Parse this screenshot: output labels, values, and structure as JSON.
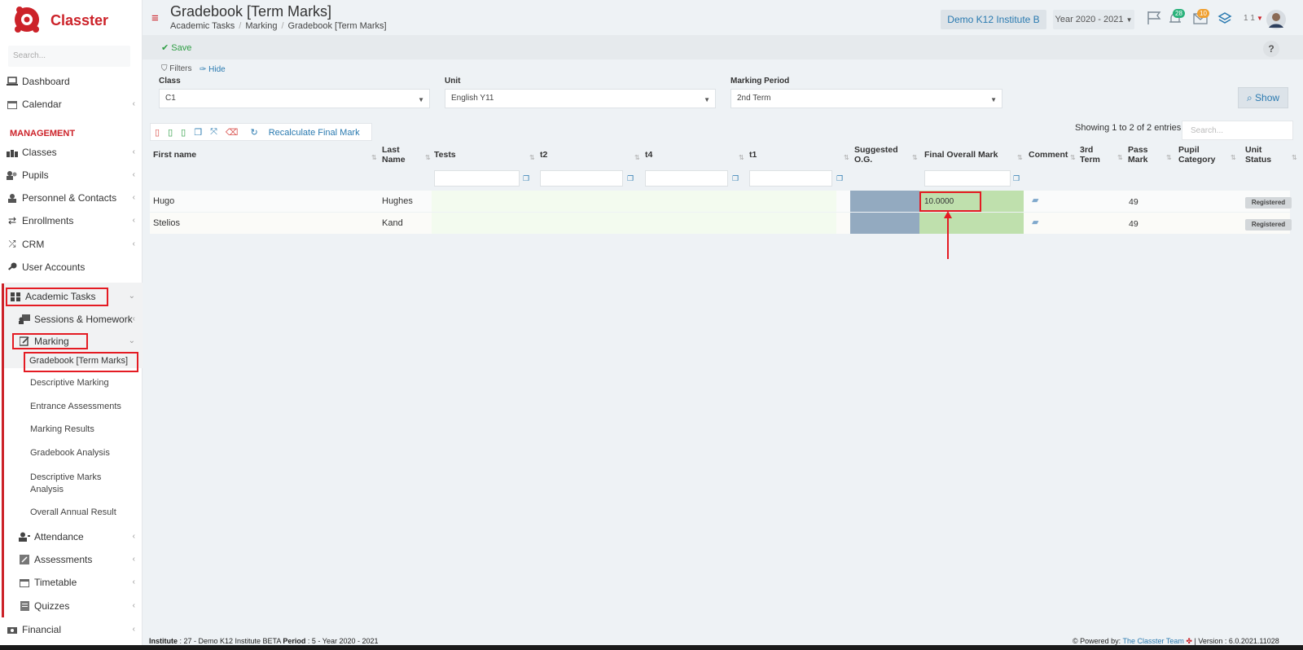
{
  "app": {
    "name": "Classter",
    "search_placeholder": "Search..."
  },
  "colors": {
    "brand": "#cc2229",
    "accent": "#2a7ab0",
    "highlight": "#e41b23",
    "final_mark_bg": "#bfe0ad",
    "suggested_bg": "#93aac0"
  },
  "sidebar": {
    "items": [
      {
        "label": "Dashboard",
        "icon": "laptop-icon"
      },
      {
        "label": "Calendar",
        "icon": "calendar-icon"
      },
      {
        "label": "Classes",
        "icon": "classes-icon"
      },
      {
        "label": "Pupils",
        "icon": "users-icon"
      },
      {
        "label": "Personnel & Contacts",
        "icon": "user-icon"
      },
      {
        "label": "Enrollments",
        "icon": "exchange-icon"
      },
      {
        "label": "CRM",
        "icon": "shuffle-icon"
      },
      {
        "label": "User Accounts",
        "icon": "key-icon"
      },
      {
        "label": "Academic Tasks",
        "icon": "grid-icon"
      },
      {
        "label": "Sessions & Homework",
        "icon": "teacher-icon"
      },
      {
        "label": "Marking",
        "icon": "edit-icon"
      },
      {
        "label": "Gradebook [Term Marks]"
      },
      {
        "label": "Descriptive Marking"
      },
      {
        "label": "Entrance Assessments"
      },
      {
        "label": "Marking Results"
      },
      {
        "label": "Gradebook Analysis"
      },
      {
        "label": "Descriptive Marks"
      },
      {
        "label": "Analysis"
      },
      {
        "label": "Overall Annual Result"
      },
      {
        "label": "Attendance",
        "icon": "attendance-icon"
      },
      {
        "label": "Assessments",
        "icon": "assessment-icon"
      },
      {
        "label": "Timetable",
        "icon": "timetable-icon"
      },
      {
        "label": "Quizzes",
        "icon": "quiz-icon"
      },
      {
        "label": "Financial",
        "icon": "money-icon"
      }
    ],
    "section_label": "MANAGEMENT"
  },
  "header": {
    "title": "Gradebook [Term Marks]",
    "breadcrumb": [
      "Academic Tasks",
      "Marking",
      "Gradebook [Term Marks]"
    ],
    "institute": "Demo K12 Institute B",
    "year": "Year 2020 - 2021",
    "notifications_count": "28",
    "messages_count": "10",
    "user_short": "1 1"
  },
  "toolbar": {
    "save_label": "Save",
    "help_label": "?"
  },
  "filters": {
    "label": "Filters",
    "hide_label": "Hide",
    "class_label": "Class",
    "class_value": "C1",
    "unit_label": "Unit",
    "unit_value": "English Y11",
    "period_label": "Marking Period",
    "period_value": "2nd Term",
    "show_label": "Show"
  },
  "table": {
    "recalc_label": "Recalculate Final Mark",
    "entries_text": "Showing 1 to 2 of 2 entries",
    "search_placeholder": "Search...",
    "columns": [
      "First name",
      "Last",
      "Name",
      "Tests",
      "t2",
      "t4",
      "t1",
      "Suggested",
      "O.G.",
      "Final Overall Mark",
      "Comment",
      "3rd",
      "Term",
      "Pass",
      "Mark",
      "Pupil",
      "Category",
      "Unit",
      "Status"
    ],
    "rows": [
      {
        "first": "Hugo",
        "last": "Hughes",
        "final": "10.0000",
        "pass": "49",
        "status": "Registered"
      },
      {
        "first": "Stelios",
        "last": "Kand",
        "final": "",
        "pass": "49",
        "status": "Registered"
      }
    ]
  },
  "footer": {
    "institute_label": "Institute",
    "institute_text": " : 27 - Demo K12 Institute BETA ",
    "period_label": "Period",
    "period_text": " : 5 - Year 2020 - 2021",
    "powered": "Powered by:",
    "team": "The Classter Team",
    "version": "| Version : 6.0.2021.11028"
  }
}
